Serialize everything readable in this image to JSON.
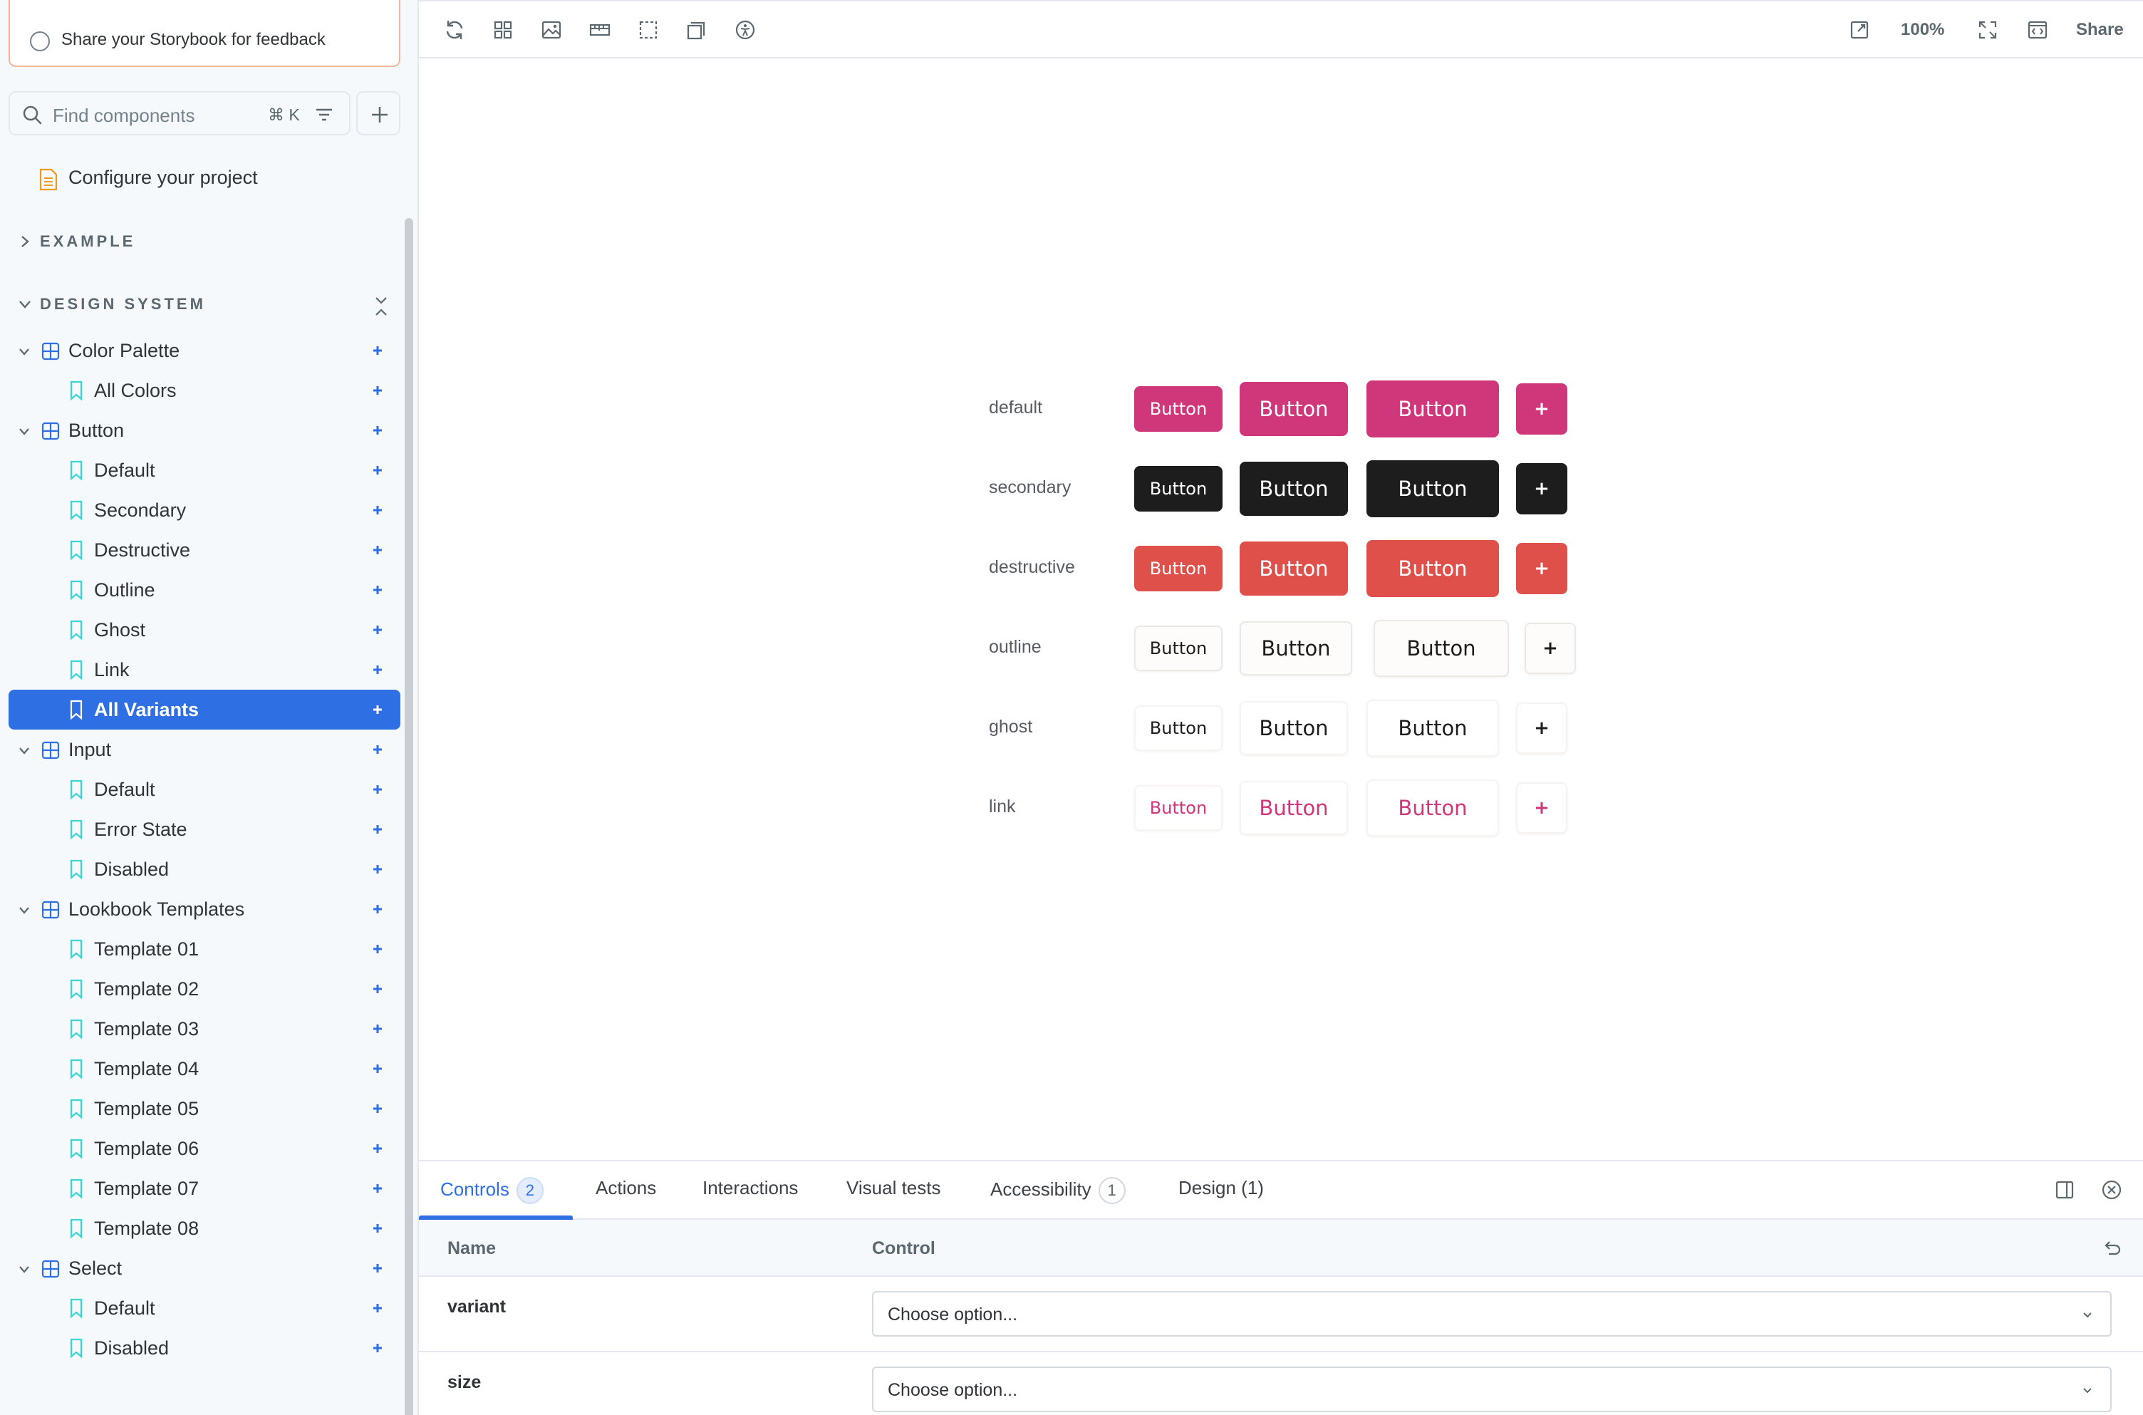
{
  "sidebar": {
    "checklist_item": "Share your Storybook for feedback",
    "search": {
      "placeholder": "Find components",
      "shortcut": "⌘ K"
    },
    "configure_label": "Configure your project",
    "sections": [
      {
        "label": "EXAMPLE",
        "expanded": false
      },
      {
        "label": "DESIGN SYSTEM",
        "expanded": true
      }
    ],
    "tree": [
      {
        "type": "component",
        "label": "Color Palette"
      },
      {
        "type": "story",
        "label": "All Colors"
      },
      {
        "type": "component",
        "label": "Button"
      },
      {
        "type": "story",
        "label": "Default"
      },
      {
        "type": "story",
        "label": "Secondary"
      },
      {
        "type": "story",
        "label": "Destructive"
      },
      {
        "type": "story",
        "label": "Outline"
      },
      {
        "type": "story",
        "label": "Ghost"
      },
      {
        "type": "story",
        "label": "Link"
      },
      {
        "type": "story",
        "label": "All Variants",
        "selected": true
      },
      {
        "type": "component",
        "label": "Input"
      },
      {
        "type": "story",
        "label": "Default"
      },
      {
        "type": "story",
        "label": "Error State"
      },
      {
        "type": "story",
        "label": "Disabled"
      },
      {
        "type": "component",
        "label": "Lookbook Templates"
      },
      {
        "type": "story",
        "label": "Template 01"
      },
      {
        "type": "story",
        "label": "Template 02"
      },
      {
        "type": "story",
        "label": "Template 03"
      },
      {
        "type": "story",
        "label": "Template 04"
      },
      {
        "type": "story",
        "label": "Template 05"
      },
      {
        "type": "story",
        "label": "Template 06"
      },
      {
        "type": "story",
        "label": "Template 07"
      },
      {
        "type": "story",
        "label": "Template 08"
      },
      {
        "type": "component",
        "label": "Select"
      },
      {
        "type": "story",
        "label": "Default"
      },
      {
        "type": "story",
        "label": "Disabled"
      }
    ]
  },
  "toolbar": {
    "left_icons": [
      "reload-icon",
      "grid-icon",
      "image-background-icon",
      "ruler-icon",
      "outline-icon",
      "measure-icon",
      "accessibility-icon"
    ],
    "right_icons": [
      "open-new-tab-icon",
      "fullscreen-icon",
      "code-icon"
    ],
    "zoom": "100%",
    "share": "Share"
  },
  "canvas": {
    "variants": [
      {
        "label": "default",
        "button": "Button",
        "icon": "+",
        "bg": "#d0367a",
        "fg": "#ffffff",
        "border": "none"
      },
      {
        "label": "secondary",
        "button": "Button",
        "icon": "+",
        "bg": "#1d1d1d",
        "fg": "#ffffff",
        "border": "none"
      },
      {
        "label": "destructive",
        "button": "Button",
        "icon": "+",
        "bg": "#e0504a",
        "fg": "#ffffff",
        "border": "none"
      },
      {
        "label": "outline",
        "button": "Button",
        "icon": "+",
        "bg": "#fdfcfb",
        "fg": "#1d1d1d",
        "border": "#ece8e4"
      },
      {
        "label": "ghost",
        "button": "Button",
        "icon": "+",
        "bg": "#ffffff",
        "fg": "#1d1d1d",
        "border": "#f6f3f1"
      },
      {
        "label": "link",
        "button": "Button",
        "icon": "+",
        "bg": "#ffffff",
        "fg": "#d0367a",
        "border": "#f6f3f1"
      }
    ]
  },
  "addons": {
    "tabs": [
      {
        "label": "Controls",
        "badge": "2",
        "active": true
      },
      {
        "label": "Actions"
      },
      {
        "label": "Interactions"
      },
      {
        "label": "Visual tests"
      },
      {
        "label": "Accessibility",
        "badge": "1"
      },
      {
        "label": "Design (1)"
      }
    ],
    "columns": {
      "name": "Name",
      "control": "Control"
    },
    "args": [
      {
        "name": "variant",
        "value": "Choose option..."
      },
      {
        "name": "size",
        "value": "Choose option..."
      }
    ]
  },
  "colors": {
    "accent": "#2f6fe4",
    "story_icon": "#37d5d3",
    "component_icon": "#2f6fe4",
    "doc_icon": "#f09a1a"
  }
}
